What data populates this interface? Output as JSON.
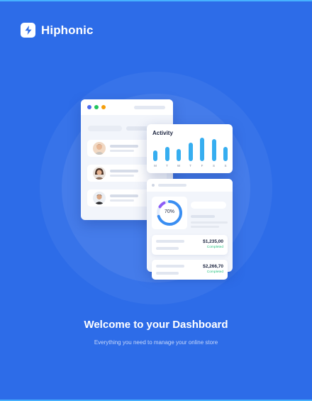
{
  "brand": {
    "name": "Hiphonic",
    "logo_icon": "bolt-icon"
  },
  "colors": {
    "background": "#2d6ce8",
    "accent_bar": "#36aef0",
    "success": "#26c281",
    "donut_purple": "#8d5cf6"
  },
  "window": {
    "dots": [
      "#4f6bed",
      "#22c55e",
      "#f59e0b"
    ],
    "users": [
      {
        "avatar_icon": "user-avatar-1"
      },
      {
        "avatar_icon": "user-avatar-2"
      },
      {
        "avatar_icon": "user-avatar-3"
      }
    ]
  },
  "activity": {
    "title": "Activity",
    "days": [
      "M",
      "T",
      "W",
      "T",
      "F",
      "S",
      "S"
    ],
    "values": [
      0.45,
      0.62,
      0.5,
      0.78,
      1.0,
      0.94,
      0.62
    ]
  },
  "stats": {
    "donut_label": "70%",
    "donut_percent": 70,
    "transactions": [
      {
        "amount": "$1,235,00",
        "status": "Completed"
      },
      {
        "amount": "$2,266,70",
        "status": "Completed"
      }
    ]
  },
  "welcome": {
    "title": "Welcome to your Dashboard",
    "subtitle": "Everything you need to manage your online store"
  }
}
